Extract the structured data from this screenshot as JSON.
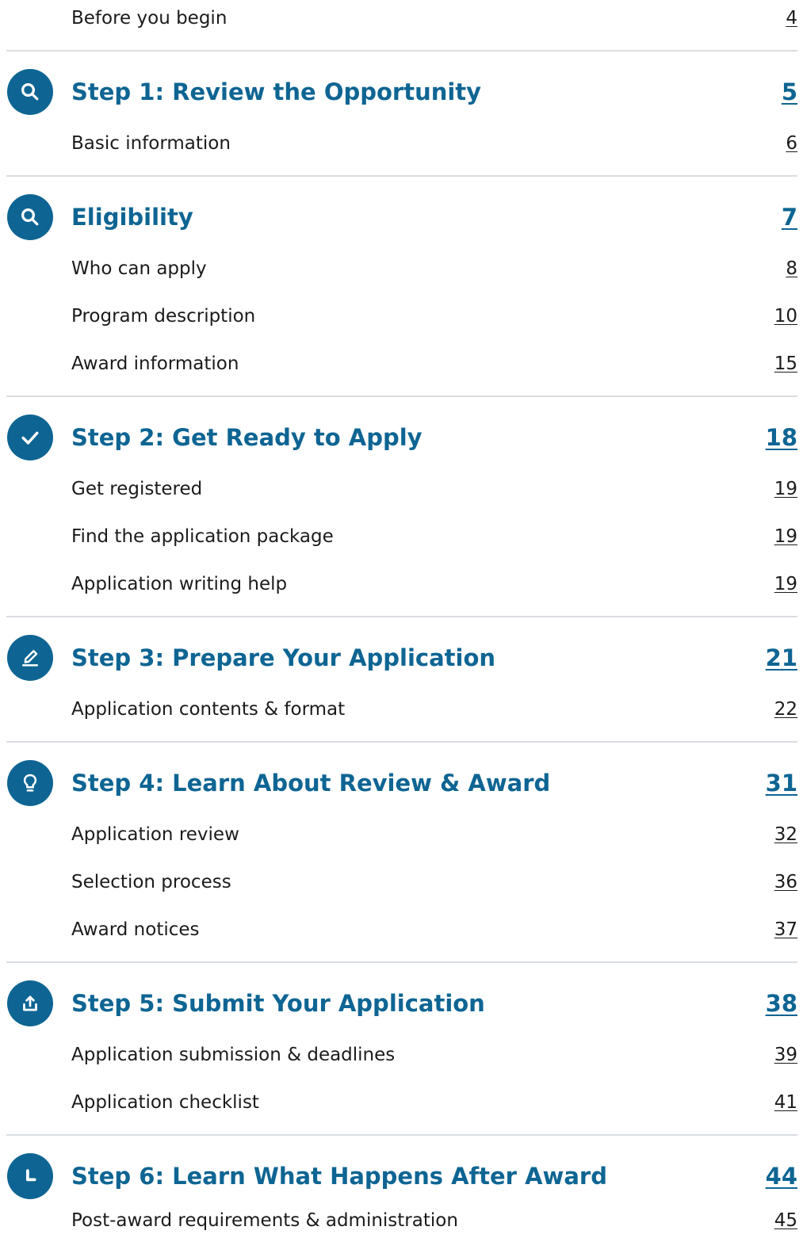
{
  "toc": {
    "before": {
      "label": "Before you begin",
      "page": "4"
    },
    "sections": [
      {
        "icon": "search-icon",
        "title": "Step 1: Review the Opportunity",
        "page": "5",
        "items": [
          {
            "label": "Basic information",
            "page": "6"
          }
        ]
      },
      {
        "icon": "search-icon",
        "title": "Eligibility",
        "page": "7",
        "items": [
          {
            "label": "Who can apply",
            "page": "8"
          },
          {
            "label": "Program description",
            "page": "10"
          },
          {
            "label": "Award information",
            "page": "15"
          }
        ]
      },
      {
        "icon": "checkmark-icon",
        "title": "Step 2: Get Ready to Apply",
        "page": "18",
        "items": [
          {
            "label": "Get registered",
            "page": "19"
          },
          {
            "label": "Find the application package",
            "page": "19"
          },
          {
            "label": "Application writing help",
            "page": "19"
          }
        ]
      },
      {
        "icon": "pencil-icon",
        "title": "Step 3: Prepare Your Application",
        "page": "21",
        "items": [
          {
            "label": "Application contents & format",
            "page": "22"
          }
        ]
      },
      {
        "icon": "lightbulb-icon",
        "title": "Step 4: Learn About Review & Award",
        "page": "31",
        "items": [
          {
            "label": "Application review",
            "page": "32"
          },
          {
            "label": "Selection process",
            "page": "36"
          },
          {
            "label": "Award notices",
            "page": "37"
          }
        ]
      },
      {
        "icon": "upload-icon",
        "title": "Step 5: Submit Your Application",
        "page": "38",
        "items": [
          {
            "label": "Application submission & deadlines",
            "page": "39"
          },
          {
            "label": "Application checklist",
            "page": "41"
          }
        ]
      },
      {
        "icon": "clock-icon",
        "title": "Step 6: Learn What Happens After Award",
        "page": "44",
        "items": [
          {
            "label": "Post-award requirements & administration",
            "page": "45"
          }
        ]
      }
    ]
  },
  "colors": {
    "heading": "#0e6593",
    "icon_bg": "#0e6593",
    "divider": "#d9dde2",
    "text": "#1b1b1b"
  }
}
